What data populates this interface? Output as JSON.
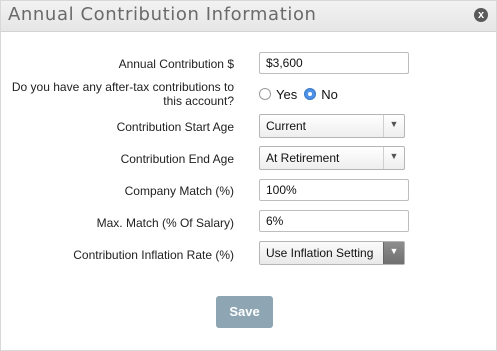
{
  "dialog": {
    "title": "Annual Contribution Information",
    "close_icon": "x"
  },
  "form": {
    "annual_contribution": {
      "label": "Annual Contribution $",
      "value": "$3,600"
    },
    "after_tax": {
      "label": "Do you have any after-tax contributions to this account?",
      "options": [
        "Yes",
        "No"
      ],
      "selected": "No"
    },
    "start_age": {
      "label": "Contribution Start Age",
      "value": "Current"
    },
    "end_age": {
      "label": "Contribution End Age",
      "value": "At Retirement"
    },
    "company_match": {
      "label": "Company Match (%)",
      "value": "100%"
    },
    "max_match": {
      "label": "Max. Match (% Of Salary)",
      "value": "6%"
    },
    "inflation_rate": {
      "label": "Contribution Inflation Rate (%)",
      "value": "Use Inflation Setting"
    }
  },
  "buttons": {
    "save": "Save"
  },
  "icons": {
    "dropdown_arrow": "▼"
  }
}
